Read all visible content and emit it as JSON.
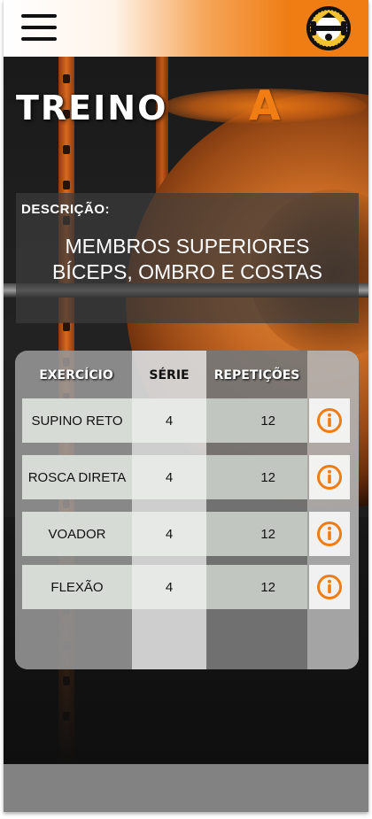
{
  "header": {
    "menu_icon": "hamburger-menu-icon",
    "logo_icon": "gym-logo-icon",
    "accent_color": "#ef7d14"
  },
  "title": {
    "word": "TREINO",
    "letter": "A"
  },
  "description": {
    "label": "DESCRIÇÃO:",
    "line1": "MEMBROS SUPERIORES",
    "line2": "BÍCEPS, OMBRO E COSTAS"
  },
  "table": {
    "headers": {
      "exercise": "EXERCÍCIO",
      "series": "SÉRIE",
      "reps": "REPETIÇÕES"
    },
    "rows": [
      {
        "name": "SUPINO RETO",
        "series": "4",
        "reps": "12",
        "icon": "info-icon"
      },
      {
        "name": "ROSCA DIRETA",
        "series": "4",
        "reps": "12",
        "icon": "info-icon"
      },
      {
        "name": "VOADOR",
        "series": "4",
        "reps": "12",
        "icon": "info-icon"
      },
      {
        "name": "FLEXÃO",
        "series": "4",
        "reps": "12",
        "icon": "info-icon"
      }
    ]
  }
}
